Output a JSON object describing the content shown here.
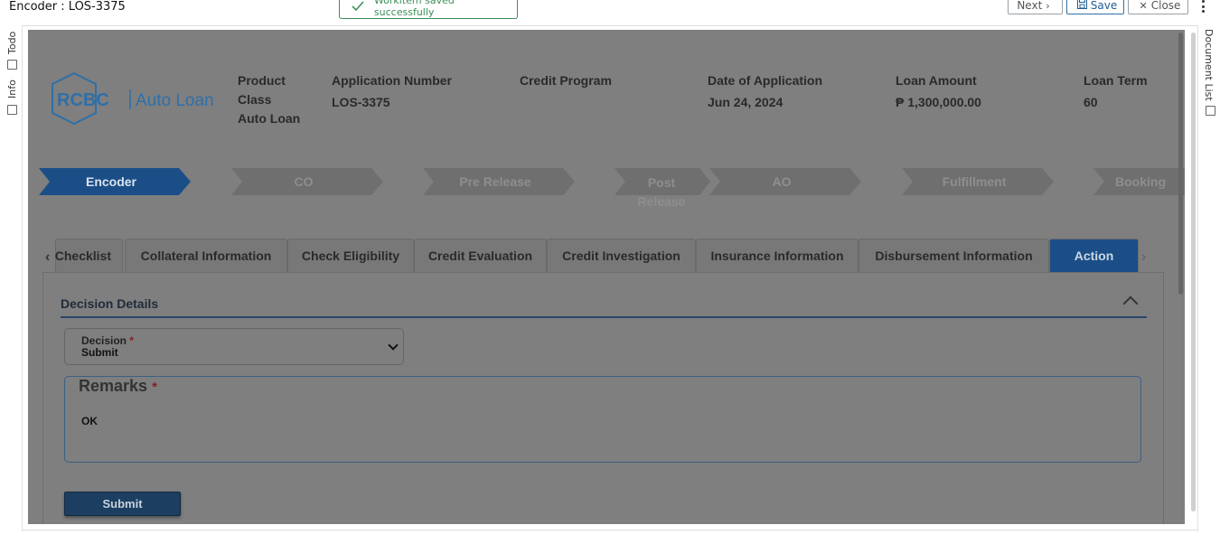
{
  "window": {
    "title": "Encoder : LOS-3375"
  },
  "toast": {
    "message": "Workitem saved successfully"
  },
  "toolbar": {
    "next_label": "Next",
    "save_label": "Save",
    "close_label": "Close"
  },
  "left_rail": {
    "items": [
      {
        "label": "Todo"
      },
      {
        "label": "Info"
      }
    ]
  },
  "right_rail": {
    "label": "Document List"
  },
  "logo": {
    "brand": "RCBC",
    "product": "Auto Loan",
    "color": "#2f6fa8"
  },
  "header": {
    "product_class": {
      "label": "Product Class",
      "label_line1": "Product",
      "label_line2": "Class",
      "value": "Auto Loan"
    },
    "application_number": {
      "label": "Application Number",
      "value": "LOS-3375"
    },
    "credit_program": {
      "label": "Credit Program",
      "value": ""
    },
    "date_of_application": {
      "label": "Date of Application",
      "value": "Jun 24, 2024"
    },
    "loan_amount": {
      "label": "Loan Amount",
      "value": "₱ 1,300,000.00"
    },
    "loan_term": {
      "label": "Loan Term",
      "value": "60"
    }
  },
  "steps": [
    {
      "label": "Encoder",
      "active": true
    },
    {
      "label": "CO",
      "active": false
    },
    {
      "label": "Pre Release",
      "active": false
    },
    {
      "label": "Post Release",
      "label_line1": "Post",
      "label_line2": "Release",
      "active": false
    },
    {
      "label": "AO",
      "active": false
    },
    {
      "label": "Fulfillment",
      "active": false
    },
    {
      "label": "Booking",
      "active": false
    }
  ],
  "tabs": [
    {
      "label": "Checklist",
      "shown": "Checklist"
    },
    {
      "label": "Collateral Information"
    },
    {
      "label": "Check Eligibility"
    },
    {
      "label": "Credit Evaluation"
    },
    {
      "label": "Credit Investigation"
    },
    {
      "label": "Insurance Information"
    },
    {
      "label": "Disbursement Information"
    },
    {
      "label": "Action",
      "active": true
    }
  ],
  "decision_section": {
    "title": "Decision Details",
    "decision": {
      "label": "Decision",
      "required_mark": "*",
      "value": "Submit"
    },
    "remarks": {
      "label": "Remarks",
      "required_mark": "*",
      "value": "OK"
    },
    "submit_label": "Submit"
  },
  "colors": {
    "accent": "#1b4e86",
    "success": "#3c8f5a",
    "overlay": "#7f7f7f"
  }
}
